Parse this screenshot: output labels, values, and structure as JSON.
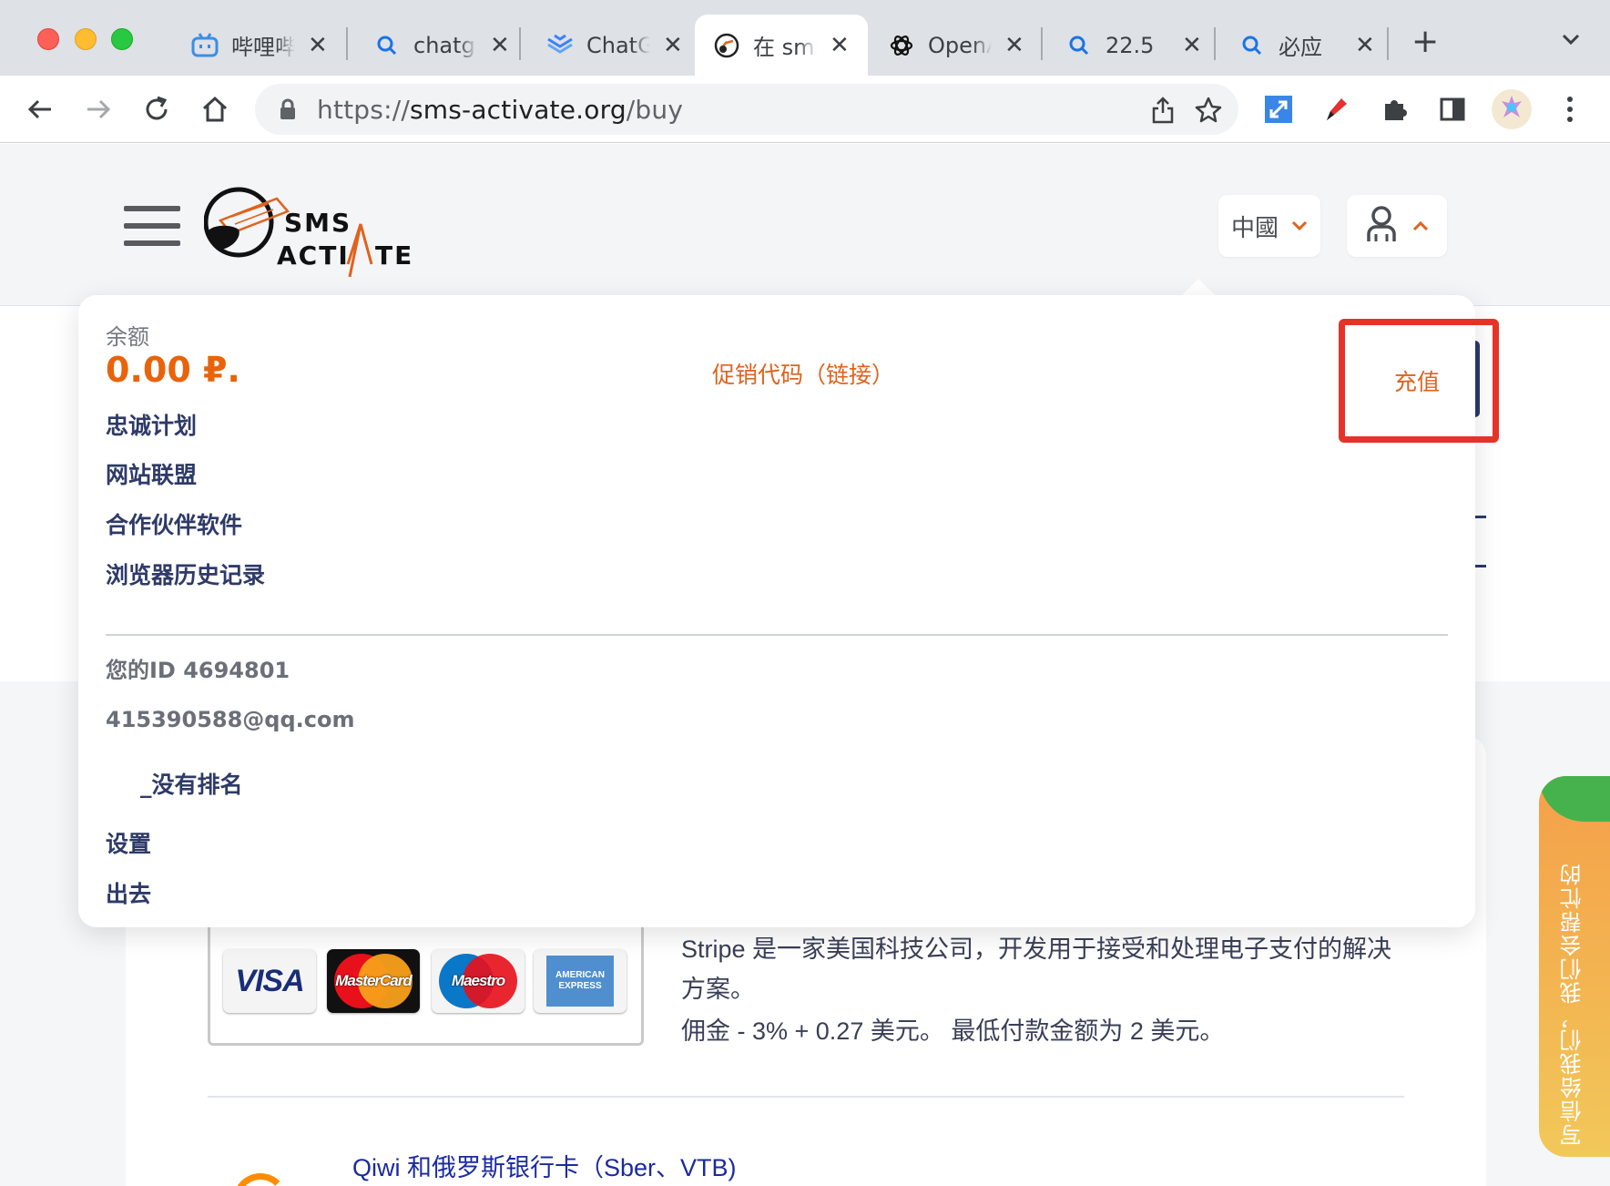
{
  "browser": {
    "tabs": [
      {
        "title": "哔哩哔哩",
        "icon": "bilibili-icon",
        "active": false
      },
      {
        "title": "chatgpt",
        "icon": "search-icon",
        "active": false
      },
      {
        "title": "ChatGPT",
        "icon": "sendbird-icon",
        "active": false
      },
      {
        "title": "在 sms",
        "icon": "sms-activate-icon",
        "active": true
      },
      {
        "title": "OpenAI",
        "icon": "openai-icon",
        "active": false
      },
      {
        "title": "22.5 ",
        "icon": "search-icon",
        "active": false
      },
      {
        "title": "必应",
        "icon": "search-icon",
        "active": false
      }
    ],
    "url_scheme": "https://",
    "url_host": "sms-activate.org",
    "url_path": "/buy"
  },
  "header": {
    "language_label": "中國"
  },
  "dropdown": {
    "balance_label": "余额",
    "balance_value": "0.00 ₽.",
    "promo_link": "促销代码（链接）",
    "topup_label": "充值",
    "menu_items": [
      "忠诚计划",
      "网站联盟",
      "合作伙伴软件",
      "浏览器历史记录"
    ],
    "user_id": "您的ID 4694801",
    "email": "415390588@qq.com",
    "rank": "_没有排名",
    "settings": "设置",
    "logout": "出去"
  },
  "payment": {
    "cards": [
      "VISA",
      "MasterCard",
      "Maestro",
      "AMERICAN EXPRESS"
    ],
    "stripe_description": "Stripe 是一家美国科技公司，开发用于接受和处理电子支付的解决方案。",
    "stripe_fee": "佣金 - 3% + 0.27 美元。 最低付款金额为 2 美元。",
    "qiwi_title": "Qiwi 和俄罗斯银行卡（Sber、VTB)"
  },
  "feedback": {
    "label": "写信给我们，我们会帮忙的"
  },
  "colors": {
    "accent_orange": "#e0621d",
    "balance_orange": "#e8630a",
    "highlight_red": "#e63329",
    "menu_navy": "#2e3a68"
  }
}
